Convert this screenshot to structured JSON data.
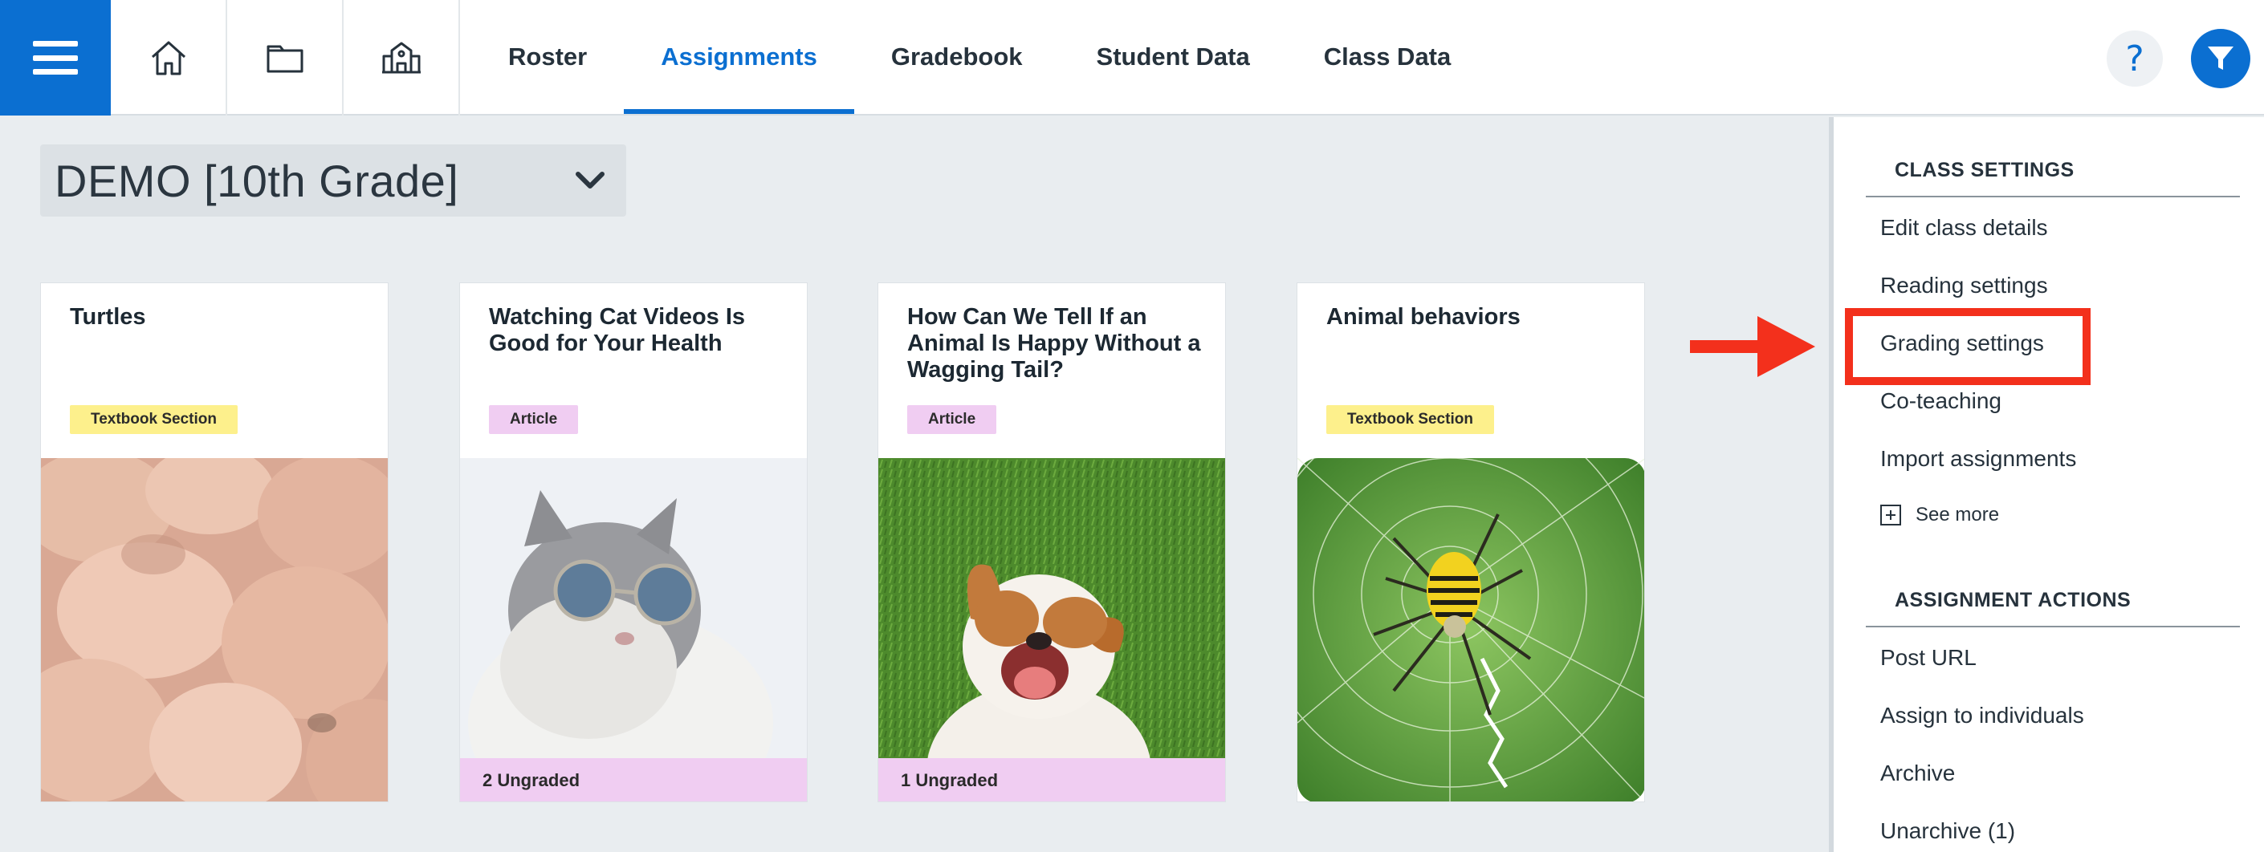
{
  "nav": {
    "icons": [
      "home-icon",
      "folder-icon",
      "school-icon"
    ],
    "tabs": [
      "Roster",
      "Assignments",
      "Gradebook",
      "Student Data",
      "Class Data"
    ],
    "active_tab": "Assignments",
    "help_label": "?",
    "accent_color": "#0b6fd1"
  },
  "class_selector": {
    "value": "DEMO [10th Grade]"
  },
  "cards": [
    {
      "title": "Turtles",
      "badge": "Textbook Section",
      "badge_type": "textbook",
      "image": "turtle-eggs-image",
      "ungraded": ""
    },
    {
      "title": "Watching Cat Videos Is Good for Your Health",
      "badge": "Article",
      "badge_type": "article",
      "image": "cat-sunglasses-image",
      "ungraded": "2 Ungraded"
    },
    {
      "title": "How Can We Tell If an Animal Is Happy Without a Wagging Tail?",
      "badge": "Article",
      "badge_type": "article",
      "image": "happy-dog-image",
      "ungraded": "1 Ungraded"
    },
    {
      "title": "Animal behaviors",
      "badge": "Textbook Section",
      "badge_type": "textbook",
      "image": "spider-web-image",
      "ungraded": ""
    }
  ],
  "sidebar": {
    "class_settings": {
      "heading": "CLASS SETTINGS",
      "items": [
        "Edit class details",
        "Reading settings",
        "Grading settings",
        "Co-teaching",
        "Import assignments"
      ],
      "see_more": "See more"
    },
    "assignment_actions": {
      "heading": "ASSIGNMENT ACTIONS",
      "items": [
        "Post URL",
        "Assign to individuals",
        "Archive",
        "Unarchive (1)"
      ]
    },
    "highlighted_item": "Grading settings",
    "highlight_color": "#f3301c"
  }
}
